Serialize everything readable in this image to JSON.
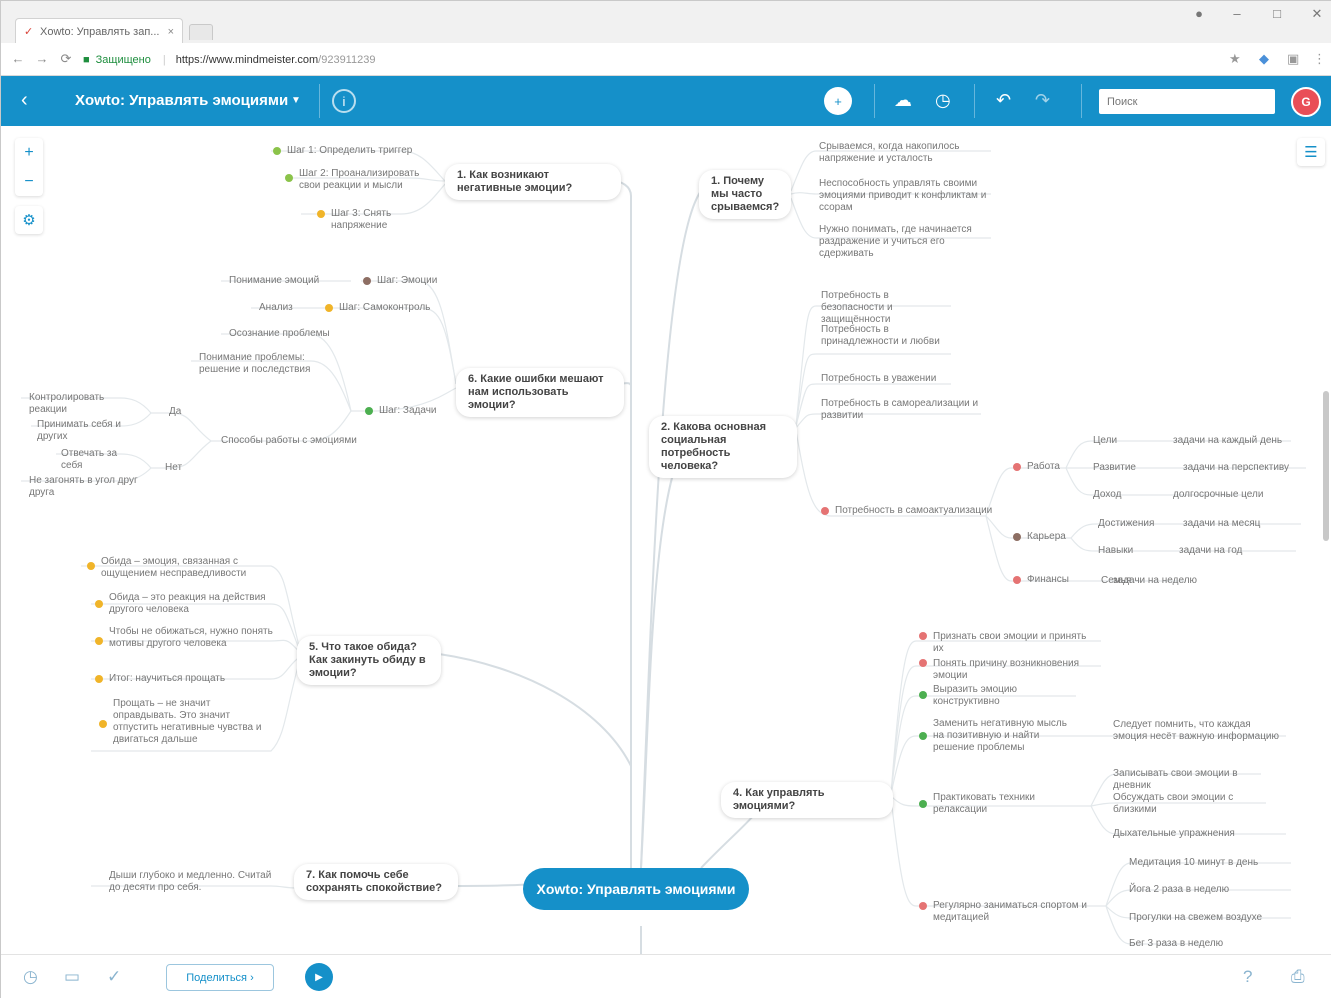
{
  "browser": {
    "tab_title": "Xowto: Управлять зап...",
    "tab_close": "×",
    "secure_label": "Защищено",
    "url_host": "https://www.mindmeister.com",
    "url_path": "/923911239"
  },
  "header": {
    "map_title": "Xowto: Управлять эмоциями",
    "search_placeholder": "Поиск",
    "avatar_initial": "G"
  },
  "map": {
    "root": "Xowto: Управлять эмоциями",
    "branches": [
      {
        "id": "b1",
        "label": "1. Как возникают негативные эмоции?"
      },
      {
        "id": "b2",
        "label": "6. Какие ошибки мешают нам использовать эмоции?"
      },
      {
        "id": "b3",
        "label": "5. Что такое обида? Как закинуть обиду в эмоции?"
      },
      {
        "id": "b4",
        "label": "7. Как помочь себе сохранять спокойствие?"
      },
      {
        "id": "b5",
        "label": "1. Почему мы часто срываемся?"
      },
      {
        "id": "b6",
        "label": "2. Какова основная социальная потребность человека?"
      },
      {
        "id": "b7",
        "label": "4. Как управлять эмоциями?"
      }
    ],
    "b1_children": [
      "Шаг 1: Определить триггер",
      "Шаг 2: Проанализировать свои реакции и мысли",
      "Шаг 3: Снять напряжение"
    ],
    "b2_children": {
      "top_items": [
        "Шаг: Эмоции",
        "Шаг: Самоконтроль"
      ],
      "top_labels": [
        "Понимание эмоций",
        "Анализ"
      ],
      "mid_items": [
        "Осознание проблемы",
        "Понимание проблемы: решение и последствия",
        "Шаг: Задачи"
      ],
      "low_label": "Способы работы с эмоциями",
      "yes_no": [
        "Да",
        "Нет"
      ],
      "leaves": [
        "Контролировать реакции",
        "Принимать себя и других",
        "Отвечать за себя",
        "Не загонять в угол друг друга"
      ]
    },
    "b3_children": [
      "Обида – эмоция, связанная с ощущением несправедливости",
      "Обида – это реакция на действия другого человека",
      "Чтобы не обижаться, нужно понять мотивы другого человека",
      "Итог: научиться прощать",
      "Прощать – не значит оправдывать. Это значит отпустить негативные чувства и двигаться дальше"
    ],
    "b4_child": "Дыши глубоко и медленно. Считай до десяти про себя.",
    "b5_children": [
      "Срываемся, когда накопилось напряжение и усталость",
      "Неспособность управлять своими эмоциями приводит к конфликтам и ссорам",
      "Нужно понимать, где начинается раздражение и учиться его сдерживать"
    ],
    "b6_children": [
      "Потребность в безопасности и защищённости",
      "Потребность в принадлежности и любви",
      "Потребность в уважении",
      "Потребность в самореализации и развитии"
    ],
    "b6_deep": {
      "label": "Потребность в самоактуализации",
      "groups": [
        "Работа",
        "Карьера",
        "Финансы"
      ],
      "leaves": [
        "Цели",
        "Развитие",
        "Доход",
        "Достижения",
        "Навыки",
        "Семья"
      ],
      "notes": [
        "задачи на каждый день",
        "задачи на перспективу",
        "долгосрочные цели",
        "задачи на месяц",
        "задачи на год",
        "задачи на неделю"
      ]
    },
    "b7_children": [
      "Признать свои эмоции и принять их",
      "Понять причину возникновения эмоции",
      "Выразить эмоцию конструктивно",
      "Заменить негативную мысль на позитивную и найти решение проблемы",
      "Практиковать техники релаксации",
      "Регулярно заниматься спортом и медитацией"
    ],
    "b7_notes": [
      "Следует помнить, что каждая эмоция несёт важную информацию",
      "Записывать свои эмоции в дневник",
      "Обсуждать свои эмоции с близкими",
      "Дыхательные упражнения",
      "Медитация 10 минут в день",
      "Йога 2 раза в неделю",
      "Прогулки на свежем воздухе",
      "Бег 3 раза в неделю"
    ]
  },
  "footer": {
    "share_label": "Поделиться ›"
  },
  "colors": {
    "brand": "#1590c9",
    "avatar": "#e94e57"
  }
}
